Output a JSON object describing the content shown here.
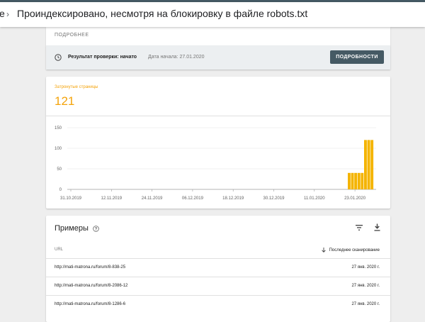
{
  "header": {
    "prev_crumb": "e",
    "separator": "›",
    "title": "Проиндексировано, несмотря на блокировку в файле robots.txt"
  },
  "status_card": {
    "more_label": "ПОДРОБНЕЕ",
    "status_label": "Результат проверки: начато",
    "start_date_label": "Дата начала: 27.01.2020",
    "details_button": "ПОДРОБНОСТИ",
    "icon": "clock-icon"
  },
  "metric": {
    "label": "Затронутые страницы",
    "value": "121",
    "color": "#f4a30a"
  },
  "chart_data": {
    "type": "bar",
    "color": "#f4b400",
    "y_ticks": [
      "0",
      "50",
      "100",
      "150"
    ],
    "ylim": [
      0,
      150
    ],
    "x_tick_labels": [
      "31.10.2019",
      "12.11.2019",
      "24.11.2019",
      "06.12.2019",
      "18.12.2019",
      "30.12.2019",
      "11.01.2020",
      "23.01.2020"
    ],
    "x": [
      "19.01.2020",
      "20.01.2020",
      "21.01.2020",
      "22.01.2020",
      "23.01.2020",
      "24.01.2020",
      "25.01.2020",
      "26.01.2020"
    ],
    "values": [
      40,
      40,
      40,
      40,
      40,
      120,
      120,
      120
    ],
    "grid": true
  },
  "examples": {
    "title": "Примеры",
    "col_url": "URL",
    "col_last_crawl": "Последнее сканирование",
    "rows": [
      {
        "url": "http://mati-matrona.ru/forum/8-838-25",
        "date": "27 янв. 2020 г."
      },
      {
        "url": "http://mati-matrona.ru/forum/8-2086-12",
        "date": "27 янв. 2020 г."
      },
      {
        "url": "http://mati-matrona.ru/forum/8-1286-6",
        "date": "27 янв. 2020 г."
      }
    ]
  }
}
